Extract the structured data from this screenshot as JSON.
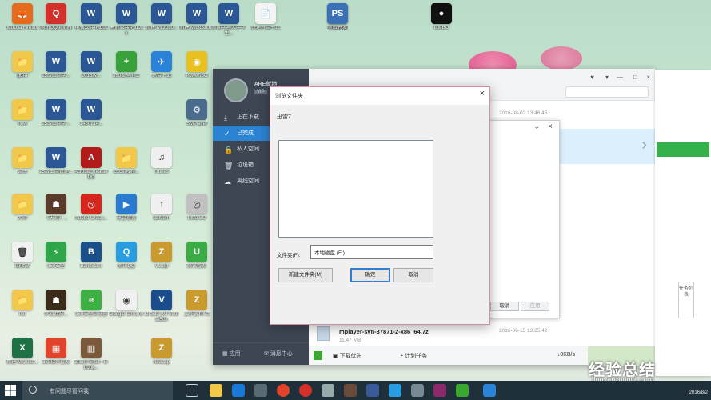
{
  "dialog": {
    "title": "浏览文件夹",
    "description": "迅雷7",
    "folder_label": "文件夹(F):",
    "folder_value": "本地磁盘 (F:)",
    "new_folder_button": "新建文件夹(M)",
    "ok_button": "确定",
    "cancel_button": "取消",
    "close": "×"
  },
  "thunder": {
    "user": "ARE就地",
    "vip": "VIP",
    "nav": [
      "正在下载",
      "已完成",
      "私人空间",
      "垃圾箱",
      "离线空间"
    ],
    "bottom_left": [
      "应用",
      "消息中心"
    ],
    "row_date_1": "2016-08-02 13:46:45",
    "file_name": "mplayer-svn-37871-2-x86_64.7z",
    "file_size": "11.47 MB",
    "file_date": "2016-06-15 13:25:42",
    "download_first": "下载优先",
    "plan_task": "计划任务",
    "speed": "0KB/s",
    "window_controls": [
      "♥",
      "▾",
      "—",
      "□",
      "×"
    ]
  },
  "second_dialog": {
    "cancel_button": "取消",
    "apply_button": "应用",
    "close": "×",
    "chevron": "⌄"
  },
  "browser": {
    "side_tab": "任务列表"
  },
  "desktop_icons": [
    {
      "label": "Mozilla Firefox",
      "color": "#e76b1c",
      "glyph": "🦊"
    },
    {
      "label": "腾讯QQ浏览器",
      "color": "#d4312c",
      "glyph": "Q"
    },
    {
      "label": "电脑公共化.doc",
      "color": "#2b5797",
      "glyph": "W"
    },
    {
      "label": "暑假公共化.docx",
      "color": "#2b5797",
      "glyph": "W"
    },
    {
      "label": "新建 Microso...",
      "color": "#2b5797",
      "glyph": "W"
    },
    {
      "label": "新建 Microsoft...",
      "color": "#2b5797",
      "glyph": "W"
    },
    {
      "label": "新闻学与大学学生...",
      "color": "#2b5797",
      "glyph": "W"
    },
    {
      "label": "快速开始平台",
      "color": "#f3f3f3",
      "glyph": "📄"
    },
    {
      "label": "守望先锋",
      "color": "#e8e8e8",
      "glyph": "◎"
    },
    {
      "label": "LIMBO",
      "color": "#111111",
      "glyph": "●"
    },
    {
      "label": "蓝眼开发",
      "color": "#3b6fb6",
      "glyph": "PS"
    },
    {
      "label": "go用",
      "color": "#f2c84b",
      "glyph": "📁"
    },
    {
      "label": "15级工商学...",
      "color": "#2b5797",
      "glyph": "W"
    },
    {
      "label": "2015级...",
      "color": "#2b5797",
      "glyph": "W"
    },
    {
      "label": "360安全卫士",
      "color": "#39a13a",
      "glyph": "+"
    },
    {
      "label": "迅雷下载",
      "color": "#2b82d9",
      "glyph": "✈"
    },
    {
      "label": "PowerISO",
      "color": "#e8c020",
      "glyph": "◉"
    },
    {
      "label": "new",
      "color": "#f2c84b",
      "glyph": "📁"
    },
    {
      "label": "15级工商学...",
      "color": "#2b5797",
      "glyph": "W"
    },
    {
      "label": "1480714...",
      "color": "#2b5797",
      "glyph": "W"
    },
    {
      "label": "SMPlayer",
      "color": "#4a6b8c",
      "glyph": "⚙"
    },
    {
      "label": "调研",
      "color": "#f2c84b",
      "glyph": "📁"
    },
    {
      "label": "15级工商管理...",
      "color": "#2b5797",
      "glyph": "W"
    },
    {
      "label": "Acrobat Reader DC",
      "color": "#b31b1b",
      "glyph": "A"
    },
    {
      "label": "Excel教程...",
      "color": "#f2c84b",
      "glyph": "📁"
    },
    {
      "label": "iTunes",
      "color": "#f0f0f0",
      "glyph": "♫"
    },
    {
      "label": "大师",
      "color": "#f2c84b",
      "glyph": "📁"
    },
    {
      "label": "《天刀》...",
      "color": "#5a3a2a",
      "glyph": "☗"
    },
    {
      "label": "Adobe Creati...",
      "color": "#d7261e",
      "glyph": "◎"
    },
    {
      "label": "迅雷看看",
      "color": "#2a7bd0",
      "glyph": "▶"
    },
    {
      "label": "Lantern",
      "color": "#f0f0f0",
      "glyph": "↑"
    },
    {
      "label": "UltraISO",
      "color": "#c0c0c0",
      "glyph": "◎"
    },
    {
      "label": "回收站",
      "color": "#f0f0f0",
      "glyph": "🗑"
    },
    {
      "label": "360安全",
      "color": "#2fa64a",
      "glyph": "⚡"
    },
    {
      "label": "Bandicam",
      "color": "#1b4f8a",
      "glyph": "B"
    },
    {
      "label": "腾讯QQ",
      "color": "#2a9ce0",
      "glyph": "Q"
    },
    {
      "label": "v1.zip",
      "color": "#c99a2e",
      "glyph": "Z"
    },
    {
      "label": "腾讯管家",
      "color": "#3bab46",
      "glyph": "U"
    },
    {
      "label": "Ino",
      "color": "#f2c84b",
      "glyph": "📁"
    },
    {
      "label": "梦幻西游...",
      "color": "#3a2a1a",
      "glyph": "☗"
    },
    {
      "label": "360安全浏览器",
      "color": "#3cb043",
      "glyph": "e"
    },
    {
      "label": "Google Chrome",
      "color": "#f0f0f0",
      "glyph": "◉"
    },
    {
      "label": "Oracle VM VirtualBox",
      "color": "#1b4d8c",
      "glyph": "V"
    },
    {
      "label": "工作资料.7z",
      "color": "#c99a2e",
      "glyph": "Z"
    },
    {
      "label": "新建 Microso...",
      "color": "#1e7145",
      "glyph": "X"
    },
    {
      "label": "360软件管家",
      "color": "#e0442b",
      "glyph": "▦"
    },
    {
      "label": "calibre 64bit - E-book...",
      "color": "#7a5a3a",
      "glyph": "▥"
    },
    {
      "label": "new.zip",
      "color": "#c99a2e",
      "glyph": "Z"
    }
  ],
  "taskbar": {
    "search_placeholder": "有问题尽管问我",
    "date": "2016/8/2"
  },
  "watermark": {
    "main": "经验总结",
    "sub": "jingyanzongjie.com"
  }
}
